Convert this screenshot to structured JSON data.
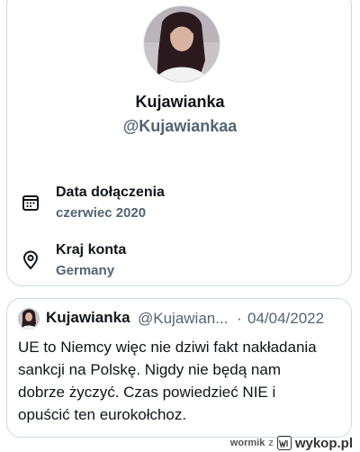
{
  "profile": {
    "display_name": "Kujawianka",
    "handle": "@Kujawiankaa",
    "avatar_icon": "profile-photo"
  },
  "info": [
    {
      "icon": "calendar-icon",
      "label": "Data dołączenia",
      "value": "czerwiec 2020"
    },
    {
      "icon": "location-pin-icon",
      "label": "Kraj konta",
      "value": "Germany"
    }
  ],
  "tweet": {
    "author_name": "Kujawianka",
    "author_handle": "@Kujawian...",
    "separator": "·",
    "date": "04/04/2022",
    "lines": [
      "UE to Niemcy więc nie dziwi fakt nakładania",
      "sankcji na Polskę. Nigdy nie będą nam",
      "dobrze życzyć. Czas powiedzieć NIE i",
      "opuścić ten eurokołchoz."
    ]
  },
  "footer": {
    "user": "wormik",
    "preposition": "z",
    "site": "wykop.pl"
  },
  "colors": {
    "text_primary": "#0f1419",
    "text_secondary": "#536471",
    "border": "#cfd9de"
  }
}
